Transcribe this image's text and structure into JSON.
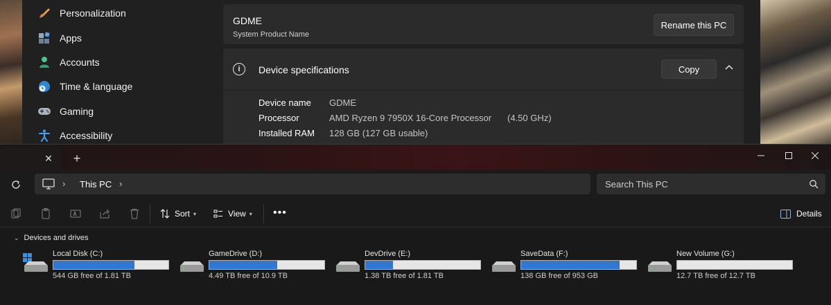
{
  "settings": {
    "nav_items": [
      {
        "label": "Personalization",
        "icon": "paintbrush-icon"
      },
      {
        "label": "Apps",
        "icon": "apps-icon"
      },
      {
        "label": "Accounts",
        "icon": "person-icon"
      },
      {
        "label": "Time & language",
        "icon": "globe-clock-icon"
      },
      {
        "label": "Gaming",
        "icon": "gamepad-icon"
      },
      {
        "label": "Accessibility",
        "icon": "accessibility-icon"
      }
    ],
    "pc_name": "GDME",
    "pc_subtitle": "System Product Name",
    "rename_label": "Rename this PC",
    "device_specs_title": "Device specifications",
    "copy_label": "Copy",
    "specs": [
      {
        "key": "Device name",
        "value": "GDME",
        "extra": ""
      },
      {
        "key": "Processor",
        "value": "AMD Ryzen 9 7950X 16-Core Processor",
        "extra": "(4.50 GHz)"
      },
      {
        "key": "Installed RAM",
        "value": "128 GB (127 GB usable)",
        "extra": ""
      }
    ]
  },
  "explorer": {
    "tab_close": "✕",
    "tab_add": "+",
    "breadcrumb": "This PC",
    "search_placeholder": "Search This PC",
    "toolbar": {
      "sort_label": "Sort",
      "view_label": "View",
      "more_label": "•••",
      "details_label": "Details"
    },
    "group_label": "Devices and drives",
    "drives": [
      {
        "name": "Local Disk (C:)",
        "free_text": "544 GB free of 1.81 TB",
        "used_fraction": 0.707,
        "system": true
      },
      {
        "name": "GameDrive (D:)",
        "free_text": "4.49 TB free of 10.9 TB",
        "used_fraction": 0.588,
        "system": false
      },
      {
        "name": "DevDrive (E:)",
        "free_text": "1.38 TB free of 1.81 TB",
        "used_fraction": 0.238,
        "system": false
      },
      {
        "name": "SaveData (F:)",
        "free_text": "138 GB free of 953 GB",
        "used_fraction": 0.855,
        "system": false
      },
      {
        "name": "New Volume (G:)",
        "free_text": "12.7 TB free of 12.7 TB",
        "used_fraction": 0.0,
        "system": false
      }
    ]
  },
  "colors": {
    "accent": "#2f77d1",
    "settings_bg": "#202020",
    "card_bg": "#2b2b2b",
    "explorer_bg": "#191919"
  }
}
